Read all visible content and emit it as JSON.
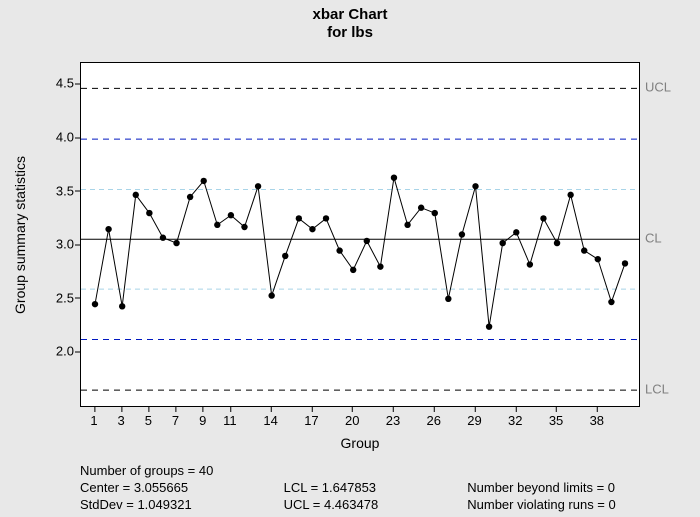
{
  "title_line1": "xbar Chart",
  "title_line2": "for lbs",
  "ylabel": "Group summary statistics",
  "xlabel": "Group",
  "y_ticks": [
    "2.0",
    "2.5",
    "3.0",
    "3.5",
    "4.0",
    "4.5"
  ],
  "x_ticks": [
    "1",
    "3",
    "5",
    "7",
    "9",
    "11",
    "14",
    "17",
    "20",
    "23",
    "26",
    "29",
    "32",
    "35",
    "38"
  ],
  "right_labels": {
    "ucl": "UCL",
    "cl": "CL",
    "lcl": "LCL"
  },
  "footer": {
    "ngroups": "Number of groups = 40",
    "center": "Center = 3.055665",
    "stddev": "StdDev = 1.049321",
    "lcl": "LCL = 1.647853",
    "ucl": "UCL = 4.463478",
    "beyond": "Number beyond limits = 0",
    "violating": "Number violating runs = 0"
  },
  "chart_data": {
    "type": "line",
    "title": "xbar Chart for lbs",
    "xlabel": "Group",
    "ylabel": "Group summary statistics",
    "ylim": [
      1.5,
      4.7
    ],
    "center": 3.055665,
    "ucl": 4.463478,
    "lcl": 1.647853,
    "sigma1_upper": 3.52,
    "sigma1_lower": 2.59,
    "sigma2_upper": 3.99,
    "sigma2_lower": 2.12,
    "x": [
      1,
      2,
      3,
      4,
      5,
      6,
      7,
      8,
      9,
      10,
      11,
      12,
      13,
      14,
      15,
      16,
      17,
      18,
      19,
      20,
      21,
      22,
      23,
      24,
      25,
      26,
      27,
      28,
      29,
      30,
      31,
      32,
      33,
      34,
      35,
      36,
      37,
      38,
      39,
      40
    ],
    "values": [
      2.45,
      3.15,
      2.43,
      3.47,
      3.3,
      3.07,
      3.02,
      3.45,
      3.6,
      3.19,
      3.28,
      3.17,
      3.55,
      2.53,
      2.9,
      3.25,
      3.15,
      3.25,
      2.95,
      2.77,
      3.04,
      2.8,
      3.63,
      3.19,
      3.35,
      3.3,
      2.5,
      3.1,
      3.55,
      2.24,
      3.02,
      3.12,
      2.82,
      3.25,
      3.02,
      3.47,
      2.95,
      2.87,
      2.47,
      2.83
    ],
    "x_tick_labels": [
      1,
      3,
      5,
      7,
      9,
      11,
      14,
      17,
      20,
      23,
      26,
      29,
      32,
      35,
      38
    ],
    "summary": {
      "n_groups": 40,
      "center": 3.055665,
      "stddev": 1.049321,
      "lcl": 1.647853,
      "ucl": 4.463478,
      "beyond_limits": 0,
      "violating_runs": 0
    }
  }
}
